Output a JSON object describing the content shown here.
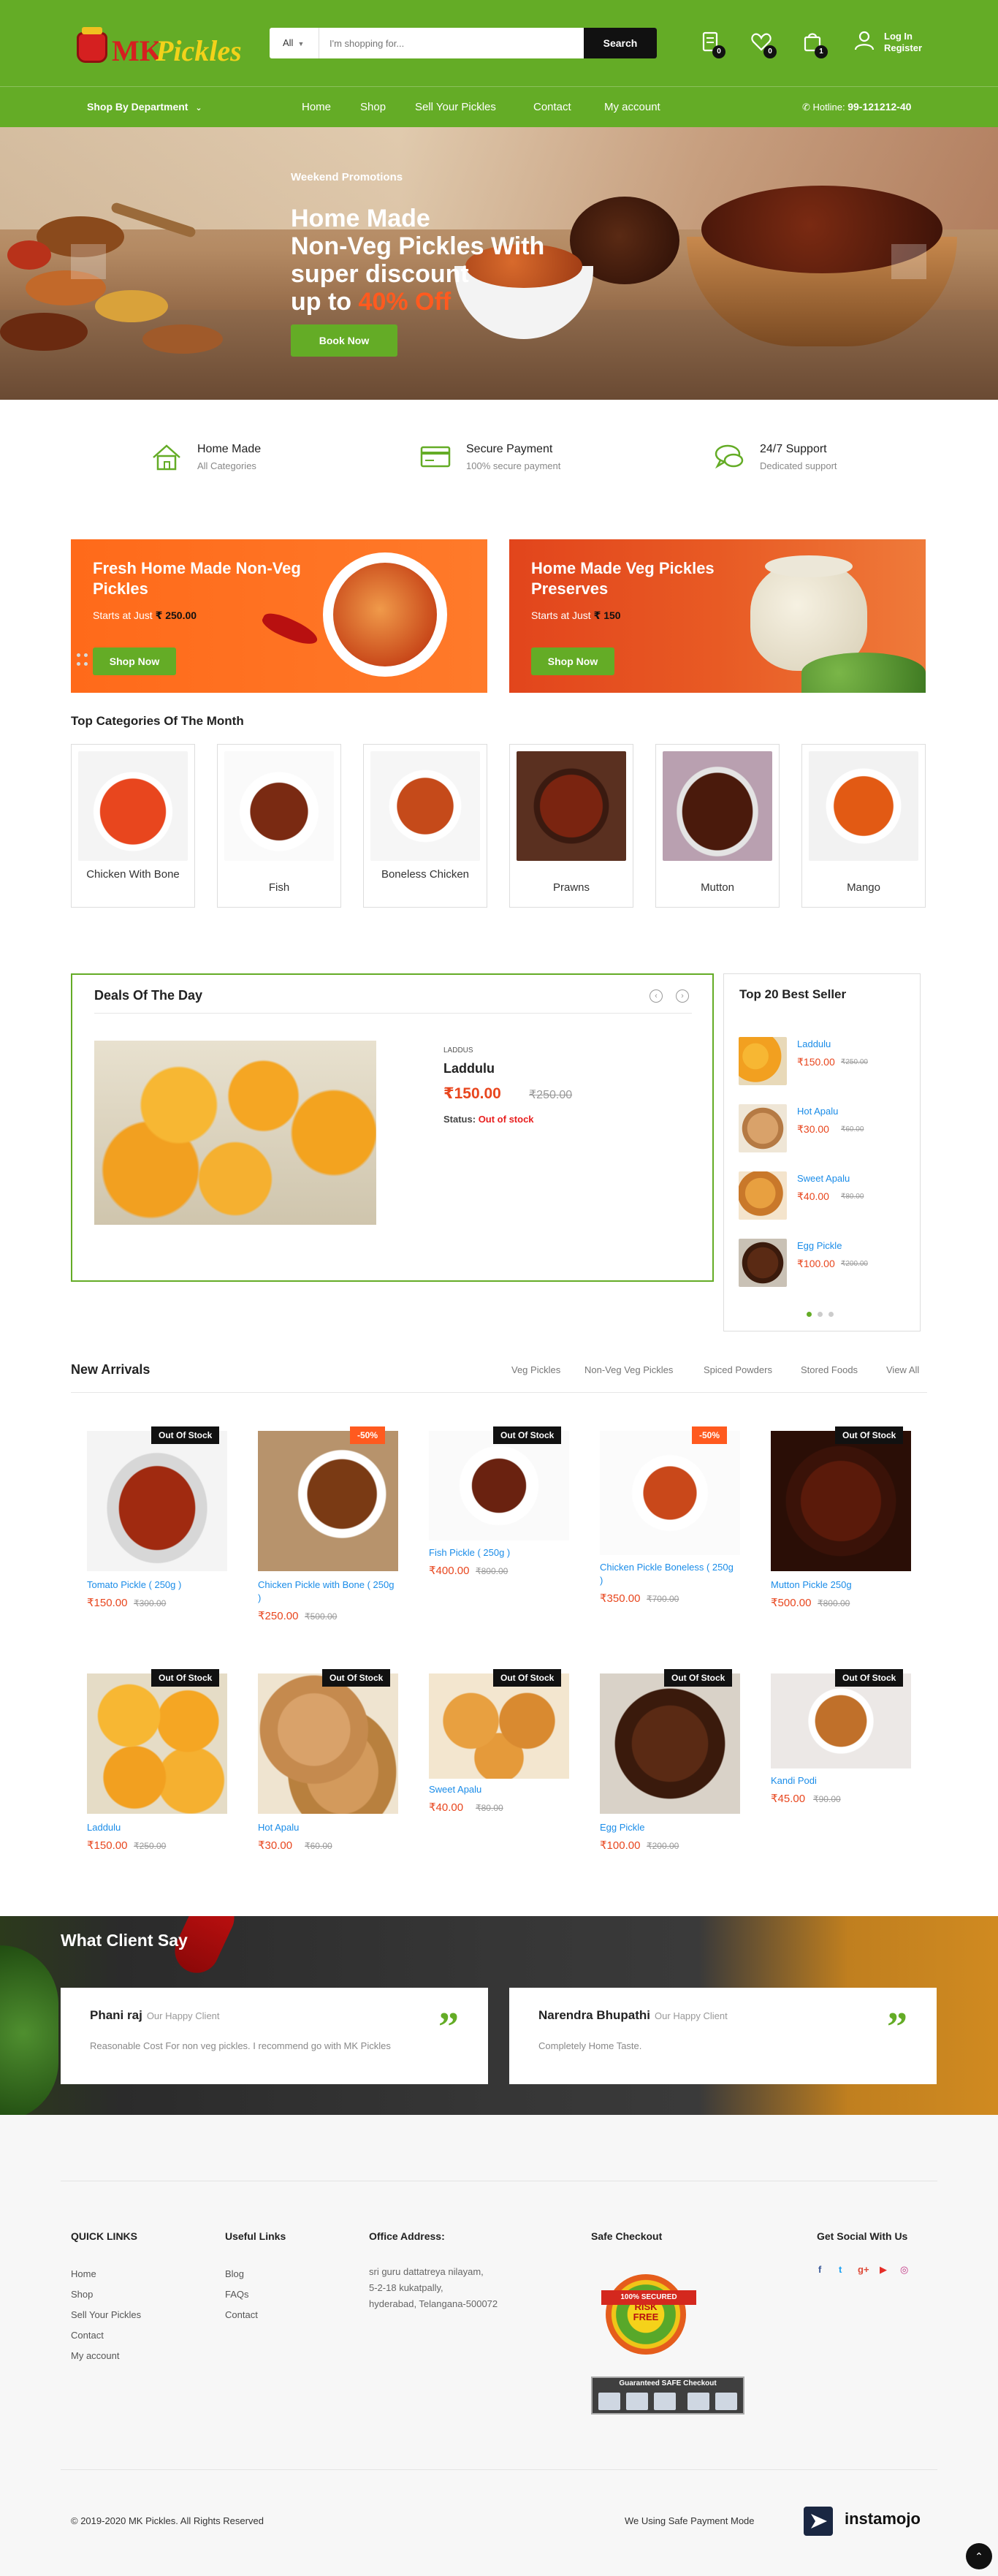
{
  "header": {
    "logo_mk": "MK",
    "logo_pickles": "Pickles",
    "search_category": "All",
    "search_placeholder": "I'm shopping for...",
    "search_button": "Search",
    "compare_count": "0",
    "wishlist_count": "0",
    "cart_count": "1",
    "login_label": "Log In",
    "register_label": "Register",
    "brand_color": "#64ac26"
  },
  "nav": {
    "department": "Shop By Department",
    "items": [
      "Home",
      "Shop",
      "Sell Your Pickles",
      "Contact",
      "My account"
    ],
    "hotline_label": "Hotline:",
    "hotline_number": "99-121212-40"
  },
  "hero": {
    "kicker": "Weekend Promotions",
    "title_line1": "Home Made",
    "title_line2": "Non-Veg Pickles With",
    "title_line3": "super discount",
    "title_line4_pre": "up to",
    "title_line4_highlight": "40% Off",
    "button": "Book Now"
  },
  "features": [
    {
      "title": "Home Made",
      "subtitle": "All Categories",
      "icon": "home-icon"
    },
    {
      "title": "Secure Payment",
      "subtitle": "100% secure payment",
      "icon": "credit-card-icon"
    },
    {
      "title": "24/7 Support",
      "subtitle": "Dedicated support",
      "icon": "chat-icon"
    }
  ],
  "promos": [
    {
      "title": "Fresh Home Made Non-Veg Pickles",
      "price_prefix": "Starts at Just",
      "price": "₹ 250.00",
      "button": "Shop Now"
    },
    {
      "title": "Home Made Veg Pickles Preserves",
      "price_prefix": "Starts at Just",
      "price": "₹ 150",
      "button": "Shop Now"
    }
  ],
  "categories": {
    "title": "Top Categories Of The Month",
    "items": [
      "Chicken With Bone",
      "Fish",
      "Boneless Chicken",
      "Prawns",
      "Mutton",
      "Mango"
    ]
  },
  "deals": {
    "title": "Deals Of The Day",
    "prev": "‹",
    "next": "›",
    "category": "LADDUS",
    "name": "Laddulu",
    "price": "₹150.00",
    "old_price": "₹250.00",
    "status_label": "Status:",
    "status_value": "Out of stock"
  },
  "best_sellers": {
    "title": "Top 20 Best Seller",
    "items": [
      {
        "name": "Laddulu",
        "price": "₹150.00",
        "old": "₹250.00"
      },
      {
        "name": "Hot Apalu",
        "price": "₹30.00",
        "old": "₹60.00"
      },
      {
        "name": "Sweet Apalu",
        "price": "₹40.00",
        "old": "₹80.00"
      },
      {
        "name": "Egg Pickle",
        "price": "₹100.00",
        "old": "₹200.00"
      }
    ]
  },
  "new_arrivals": {
    "title": "New Arrivals",
    "tabs": [
      "Veg Pickles",
      "Non-Veg Veg Pickles",
      "Spiced Powders",
      "Stored Foods",
      "View All"
    ],
    "products": [
      {
        "name": "Tomato Pickle ( 250g )",
        "price": "₹150.00",
        "old": "₹300.00",
        "badge": "Out Of Stock"
      },
      {
        "name": "Chicken Pickle with Bone ( 250g )",
        "price": "₹250.00",
        "old": "₹500.00",
        "badge": "-50%"
      },
      {
        "name": "Fish Pickle ( 250g )",
        "price": "₹400.00",
        "old": "₹800.00",
        "badge": "Out Of Stock"
      },
      {
        "name": "Chicken Pickle Boneless ( 250g )",
        "price": "₹350.00",
        "old": "₹700.00",
        "badge": "-50%"
      },
      {
        "name": "Mutton Pickle 250g",
        "price": "₹500.00",
        "old": "₹800.00",
        "badge": "Out Of Stock"
      },
      {
        "name": "Laddulu",
        "price": "₹150.00",
        "old": "₹250.00",
        "badge": "Out Of Stock"
      },
      {
        "name": "Hot Apalu",
        "price": "₹30.00",
        "old": "₹60.00",
        "badge": "Out Of Stock"
      },
      {
        "name": "Sweet Apalu",
        "price": "₹40.00",
        "old": "₹80.00",
        "badge": "Out Of Stock"
      },
      {
        "name": "Egg Pickle",
        "price": "₹100.00",
        "old": "₹200.00",
        "badge": "Out Of Stock"
      },
      {
        "name": "Kandi Podi",
        "price": "₹45.00",
        "old": "₹90.00",
        "badge": "Out Of Stock"
      }
    ]
  },
  "testimonials": {
    "title": "What Client Say",
    "items": [
      {
        "name": "Phani raj",
        "role": "Our Happy Client",
        "text": "Reasonable Cost For non veg pickles. I recommend go with MK Pickles"
      },
      {
        "name": "Narendra Bhupathi",
        "role": "Our Happy Client",
        "text": "Completely Home Taste."
      }
    ]
  },
  "footer": {
    "quick_links_title": "QUICK LINKS",
    "quick_links": [
      "Home",
      "Shop",
      "Sell Your Pickles",
      "Contact",
      "My account"
    ],
    "useful_links_title": "Useful Links",
    "useful_links": [
      "Blog",
      "FAQs",
      "Contact"
    ],
    "address_title": "Office Address:",
    "address_lines": [
      "sri guru dattatreya nilayam,",
      "5-2-18 kukatpally,",
      "hyderabad, Telangana-500072"
    ],
    "checkout_title": "Safe Checkout",
    "seal_line1": "RISK",
    "seal_line2": "FREE",
    "seal_ribbon": "100% SECURED",
    "guarantee_text": "Guaranteed SAFE Checkout",
    "social_title": "Get Social With Us",
    "social": [
      "f",
      "t",
      "g+",
      "▶",
      "◎"
    ],
    "copyright": "© 2019-2020 MK Pickles. All Rights Reserved",
    "safe_payment": "We Using Safe Payment Mode",
    "payment_brand": "instamojo"
  },
  "scroll_top": "⌃"
}
